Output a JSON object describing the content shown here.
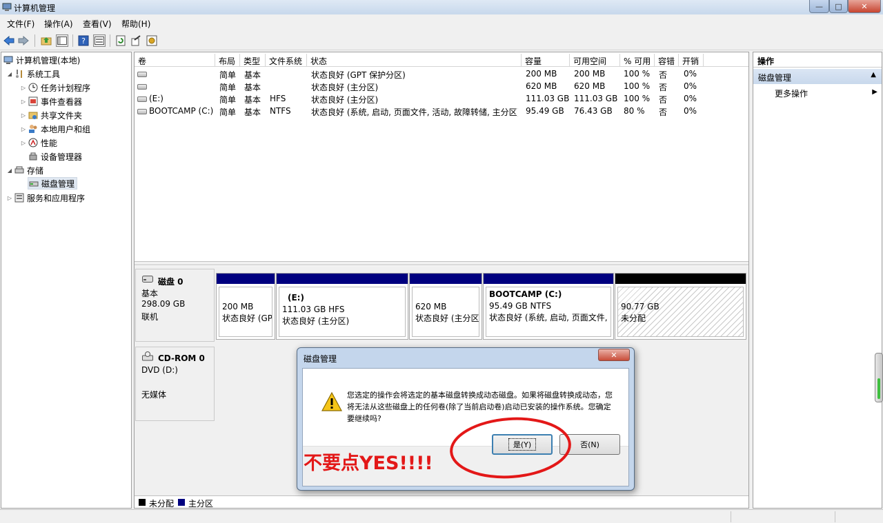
{
  "window": {
    "title": "计算机管理"
  },
  "menubar": [
    "文件(F)",
    "操作(A)",
    "查看(V)",
    "帮助(H)"
  ],
  "toolbar_icons": [
    "back-arrow-icon",
    "forward-arrow-icon",
    "up-folder-icon",
    "show-tree-icon",
    "help-icon",
    "properties-icon",
    "refresh-icon",
    "export-icon",
    "help-topic-icon"
  ],
  "tree": {
    "root": "计算机管理(本地)",
    "system_tools": "系统工具",
    "task_scheduler": "任务计划程序",
    "event_viewer": "事件查看器",
    "shared_folders": "共享文件夹",
    "local_users": "本地用户和组",
    "performance": "性能",
    "device_manager": "设备管理器",
    "storage": "存储",
    "disk_management": "磁盘管理",
    "services_apps": "服务和应用程序"
  },
  "volume_table": {
    "headers": [
      "卷",
      "布局",
      "类型",
      "文件系统",
      "状态",
      "容量",
      "可用空间",
      "% 可用",
      "容错",
      "开销"
    ],
    "rows": [
      {
        "vol": "",
        "layout": "简单",
        "type": "基本",
        "fs": "",
        "status": "状态良好 (GPT 保护分区)",
        "capacity": "200 MB",
        "free": "200 MB",
        "pct": "100 %",
        "ft": "否",
        "overhead": "0%"
      },
      {
        "vol": "",
        "layout": "简单",
        "type": "基本",
        "fs": "",
        "status": "状态良好 (主分区)",
        "capacity": "620 MB",
        "free": "620 MB",
        "pct": "100 %",
        "ft": "否",
        "overhead": "0%"
      },
      {
        "vol": "(E:)",
        "layout": "简单",
        "type": "基本",
        "fs": "HFS",
        "status": "状态良好 (主分区)",
        "capacity": "111.03 GB",
        "free": "111.03 GB",
        "pct": "100 %",
        "ft": "否",
        "overhead": "0%"
      },
      {
        "vol": "BOOTCAMP (C:)",
        "layout": "简单",
        "type": "基本",
        "fs": "NTFS",
        "status": "状态良好 (系统, 启动, 页面文件, 活动, 故障转储, 主分区)",
        "capacity": "95.49 GB",
        "free": "76.43 GB",
        "pct": "80 %",
        "ft": "否",
        "overhead": "0%"
      }
    ]
  },
  "disk0": {
    "name": "磁盘 0",
    "type": "基本",
    "size": "298.09 GB",
    "state": "联机",
    "partitions": [
      {
        "title": "",
        "size": "200 MB",
        "status": "状态良好 (GP"
      },
      {
        "title": "(E:)",
        "size": "111.03 GB HFS",
        "status": "状态良好 (主分区)"
      },
      {
        "title": "",
        "size": "620 MB",
        "status": "状态良好 (主分区"
      },
      {
        "title": "BOOTCAMP  (C:)",
        "size": "95.49 GB NTFS",
        "status": "状态良好 (系统, 启动, 页面文件, ;"
      },
      {
        "title": "",
        "size": "90.77 GB",
        "status": "未分配"
      }
    ]
  },
  "cdrom0": {
    "name": "CD-ROM 0",
    "drive": "DVD (D:)",
    "media": "无媒体"
  },
  "legend": {
    "unallocated": "未分配",
    "primary": "主分区"
  },
  "actions": {
    "header": "操作",
    "section": "磁盘管理",
    "more": "更多操作"
  },
  "dialog": {
    "title": "磁盘管理",
    "message": "您选定的操作会将选定的基本磁盘转换成动态磁盘。如果将磁盘转换成动态，您将无法从这些磁盘上的任何卷(除了当前启动卷)启动已安装的操作系统。您确定要继续吗?",
    "yes_label": "是(Y)",
    "no_label": "否(N)"
  },
  "annotation": {
    "text": "不要点YES!!!!",
    "color": "#e31818"
  },
  "colors": {
    "primary_partition": "#00007f",
    "unallocated": "#000000"
  }
}
